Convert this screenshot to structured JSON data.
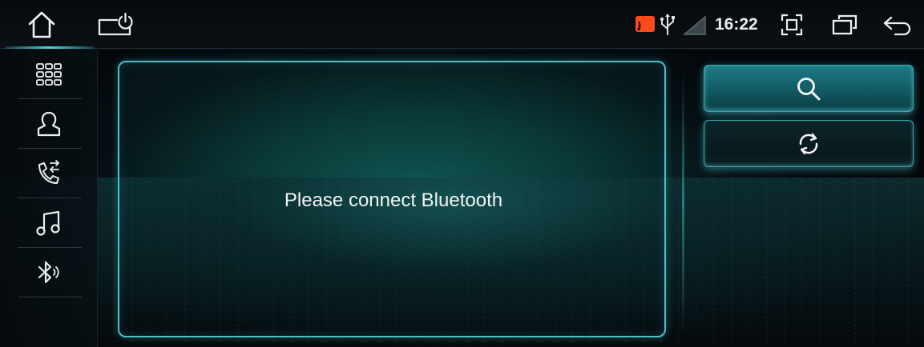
{
  "status_bar": {
    "time": "16:22",
    "icons": [
      "home-icon",
      "car-power-icon",
      "screen-cast-icon",
      "usb-icon",
      "signal-icon",
      "screenshot-icon",
      "recent-apps-icon",
      "back-icon"
    ]
  },
  "sidebar": {
    "items": [
      {
        "name": "apps-grid",
        "icon": "grid-icon"
      },
      {
        "name": "contacts",
        "icon": "person-icon"
      },
      {
        "name": "call-log",
        "icon": "phone-transfer-icon"
      },
      {
        "name": "music",
        "icon": "music-note-icon"
      },
      {
        "name": "bluetooth",
        "icon": "bluetooth-icon"
      }
    ]
  },
  "main": {
    "message": "Please connect Bluetooth"
  },
  "actions": {
    "search_icon": "search-icon",
    "refresh_icon": "refresh-icon"
  },
  "colors": {
    "accent": "#54d3dc",
    "cast_icon": "#ff4a1c",
    "text": "#f2f4f5"
  }
}
